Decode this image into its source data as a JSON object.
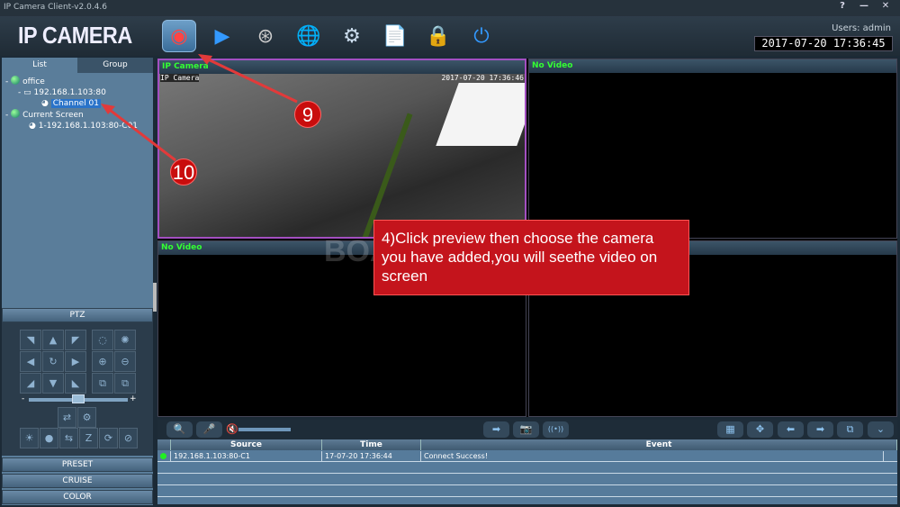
{
  "window": {
    "title": "IP Camera Client-v2.0.4.6",
    "controls": [
      "?",
      "—",
      "✕"
    ]
  },
  "header": {
    "logo": "IP CAMERA",
    "users": "Users: admin",
    "datetime": "2017-07-20  17:36:45",
    "toolbar": [
      {
        "name": "preview",
        "glyph": "◉",
        "active": true
      },
      {
        "name": "playback",
        "glyph": "▶"
      },
      {
        "name": "ptz-wheel",
        "glyph": "⊛"
      },
      {
        "name": "network-globe",
        "glyph": "🌐"
      },
      {
        "name": "settings-gear",
        "glyph": "⚙"
      },
      {
        "name": "log-document",
        "glyph": "📄"
      },
      {
        "name": "lock",
        "glyph": "🔒"
      },
      {
        "name": "power",
        "glyph": "⏻"
      }
    ]
  },
  "sidebar": {
    "tabs": [
      "List",
      "Group"
    ],
    "tree": [
      {
        "expander": "-",
        "label": "office",
        "level": 0
      },
      {
        "expander": "-",
        "label": "192.168.1.103:80",
        "level": 1
      },
      {
        "label": "Channel 01",
        "level": 2,
        "selected": true
      },
      {
        "expander": "-",
        "label": "Current Screen",
        "level": 0
      },
      {
        "label": "1-192.168.1.103:80-C01",
        "level": 1
      }
    ],
    "ptz_label": "PTZ",
    "slider_minus": "-",
    "slider_plus": "+",
    "preset": "PRESET",
    "cruise": "CRUISE",
    "color": "COLOR"
  },
  "video": {
    "cells": [
      {
        "title": "IP Camera",
        "active": true,
        "overlay_name": "IP Camera",
        "overlay_time": "2017-07-20 17:36:46"
      },
      {
        "title": "No Video"
      },
      {
        "title": "No Video"
      },
      {
        "title": ""
      }
    ]
  },
  "log": {
    "headers": [
      "Source",
      "Time",
      "Event"
    ],
    "rows": [
      {
        "status": "green",
        "source": "192.168.1.103:80-C1",
        "time": "17-07-20 17:36:44",
        "event": "Connect Success!"
      }
    ]
  },
  "annotation": {
    "text": "4)Click preview then choose the camera you have added,you will seethe video on screen",
    "badge_9": "9",
    "badge_10": "10",
    "watermark": "BOAVISION",
    "color": "#c4141c"
  }
}
